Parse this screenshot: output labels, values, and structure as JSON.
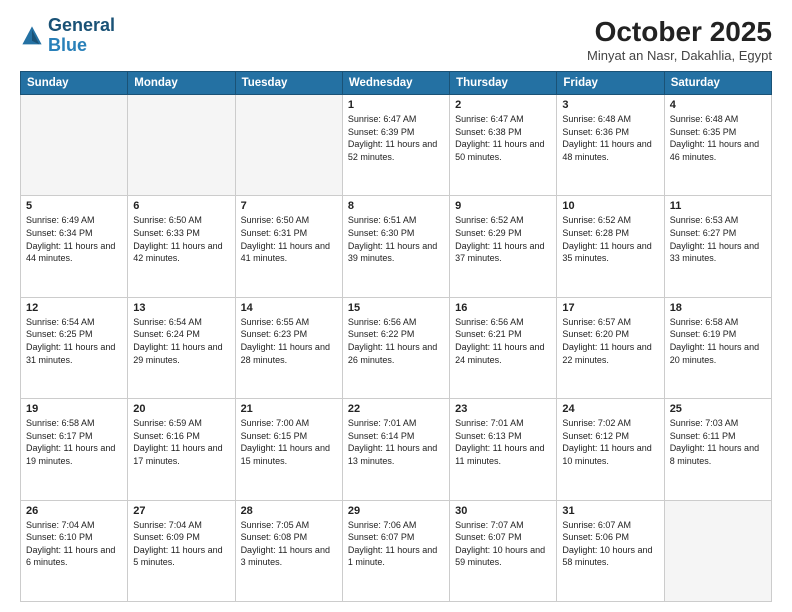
{
  "header": {
    "logo_line1": "General",
    "logo_line2": "Blue",
    "month": "October 2025",
    "location": "Minyat an Nasr, Dakahlia, Egypt"
  },
  "days": [
    "Sunday",
    "Monday",
    "Tuesday",
    "Wednesday",
    "Thursday",
    "Friday",
    "Saturday"
  ],
  "weeks": [
    [
      {
        "num": "",
        "info": ""
      },
      {
        "num": "",
        "info": ""
      },
      {
        "num": "",
        "info": ""
      },
      {
        "num": "1",
        "info": "Sunrise: 6:47 AM\nSunset: 6:39 PM\nDaylight: 11 hours\nand 52 minutes."
      },
      {
        "num": "2",
        "info": "Sunrise: 6:47 AM\nSunset: 6:38 PM\nDaylight: 11 hours\nand 50 minutes."
      },
      {
        "num": "3",
        "info": "Sunrise: 6:48 AM\nSunset: 6:36 PM\nDaylight: 11 hours\nand 48 minutes."
      },
      {
        "num": "4",
        "info": "Sunrise: 6:48 AM\nSunset: 6:35 PM\nDaylight: 11 hours\nand 46 minutes."
      }
    ],
    [
      {
        "num": "5",
        "info": "Sunrise: 6:49 AM\nSunset: 6:34 PM\nDaylight: 11 hours\nand 44 minutes."
      },
      {
        "num": "6",
        "info": "Sunrise: 6:50 AM\nSunset: 6:33 PM\nDaylight: 11 hours\nand 42 minutes."
      },
      {
        "num": "7",
        "info": "Sunrise: 6:50 AM\nSunset: 6:31 PM\nDaylight: 11 hours\nand 41 minutes."
      },
      {
        "num": "8",
        "info": "Sunrise: 6:51 AM\nSunset: 6:30 PM\nDaylight: 11 hours\nand 39 minutes."
      },
      {
        "num": "9",
        "info": "Sunrise: 6:52 AM\nSunset: 6:29 PM\nDaylight: 11 hours\nand 37 minutes."
      },
      {
        "num": "10",
        "info": "Sunrise: 6:52 AM\nSunset: 6:28 PM\nDaylight: 11 hours\nand 35 minutes."
      },
      {
        "num": "11",
        "info": "Sunrise: 6:53 AM\nSunset: 6:27 PM\nDaylight: 11 hours\nand 33 minutes."
      }
    ],
    [
      {
        "num": "12",
        "info": "Sunrise: 6:54 AM\nSunset: 6:25 PM\nDaylight: 11 hours\nand 31 minutes."
      },
      {
        "num": "13",
        "info": "Sunrise: 6:54 AM\nSunset: 6:24 PM\nDaylight: 11 hours\nand 29 minutes."
      },
      {
        "num": "14",
        "info": "Sunrise: 6:55 AM\nSunset: 6:23 PM\nDaylight: 11 hours\nand 28 minutes."
      },
      {
        "num": "15",
        "info": "Sunrise: 6:56 AM\nSunset: 6:22 PM\nDaylight: 11 hours\nand 26 minutes."
      },
      {
        "num": "16",
        "info": "Sunrise: 6:56 AM\nSunset: 6:21 PM\nDaylight: 11 hours\nand 24 minutes."
      },
      {
        "num": "17",
        "info": "Sunrise: 6:57 AM\nSunset: 6:20 PM\nDaylight: 11 hours\nand 22 minutes."
      },
      {
        "num": "18",
        "info": "Sunrise: 6:58 AM\nSunset: 6:19 PM\nDaylight: 11 hours\nand 20 minutes."
      }
    ],
    [
      {
        "num": "19",
        "info": "Sunrise: 6:58 AM\nSunset: 6:17 PM\nDaylight: 11 hours\nand 19 minutes."
      },
      {
        "num": "20",
        "info": "Sunrise: 6:59 AM\nSunset: 6:16 PM\nDaylight: 11 hours\nand 17 minutes."
      },
      {
        "num": "21",
        "info": "Sunrise: 7:00 AM\nSunset: 6:15 PM\nDaylight: 11 hours\nand 15 minutes."
      },
      {
        "num": "22",
        "info": "Sunrise: 7:01 AM\nSunset: 6:14 PM\nDaylight: 11 hours\nand 13 minutes."
      },
      {
        "num": "23",
        "info": "Sunrise: 7:01 AM\nSunset: 6:13 PM\nDaylight: 11 hours\nand 11 minutes."
      },
      {
        "num": "24",
        "info": "Sunrise: 7:02 AM\nSunset: 6:12 PM\nDaylight: 11 hours\nand 10 minutes."
      },
      {
        "num": "25",
        "info": "Sunrise: 7:03 AM\nSunset: 6:11 PM\nDaylight: 11 hours\nand 8 minutes."
      }
    ],
    [
      {
        "num": "26",
        "info": "Sunrise: 7:04 AM\nSunset: 6:10 PM\nDaylight: 11 hours\nand 6 minutes."
      },
      {
        "num": "27",
        "info": "Sunrise: 7:04 AM\nSunset: 6:09 PM\nDaylight: 11 hours\nand 5 minutes."
      },
      {
        "num": "28",
        "info": "Sunrise: 7:05 AM\nSunset: 6:08 PM\nDaylight: 11 hours\nand 3 minutes."
      },
      {
        "num": "29",
        "info": "Sunrise: 7:06 AM\nSunset: 6:07 PM\nDaylight: 11 hours\nand 1 minute."
      },
      {
        "num": "30",
        "info": "Sunrise: 7:07 AM\nSunset: 6:07 PM\nDaylight: 10 hours\nand 59 minutes."
      },
      {
        "num": "31",
        "info": "Sunrise: 6:07 AM\nSunset: 5:06 PM\nDaylight: 10 hours\nand 58 minutes."
      },
      {
        "num": "",
        "info": ""
      }
    ]
  ]
}
